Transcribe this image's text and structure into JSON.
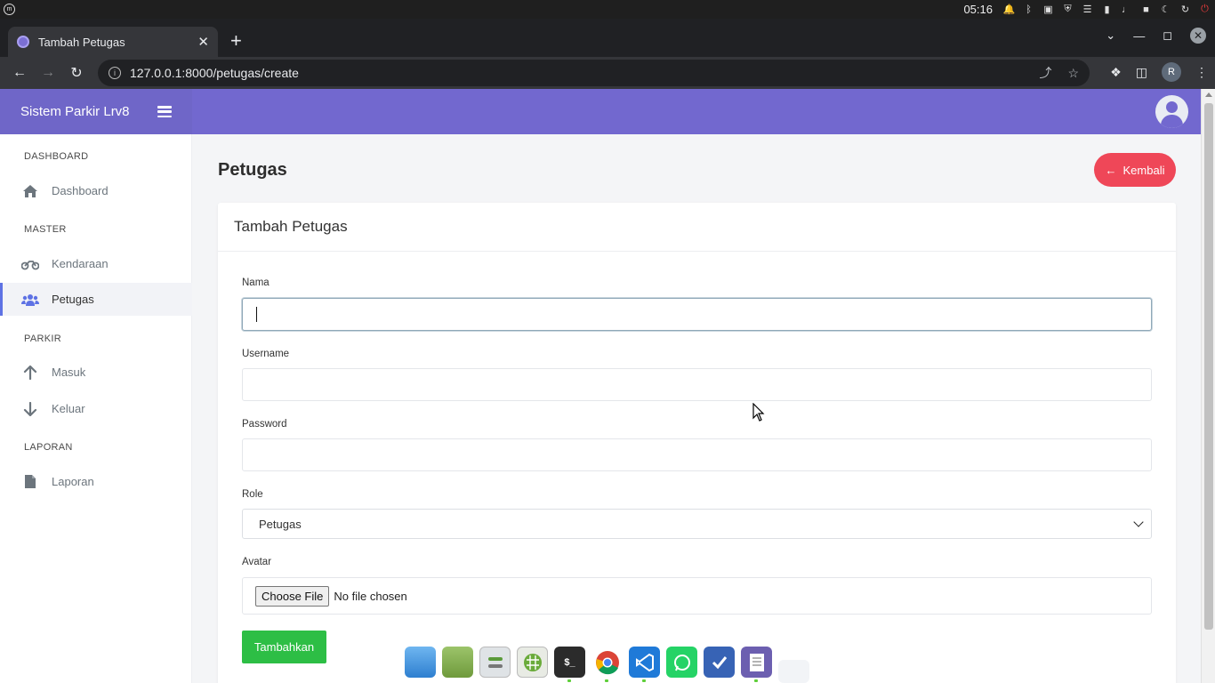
{
  "os": {
    "time": "05:16"
  },
  "browser": {
    "tab_title": "Tambah Petugas",
    "url": "127.0.0.1:8000/petugas/create",
    "profile_initial": "R"
  },
  "app": {
    "brand": "Sistem Parkir Lrv8",
    "accent_color": "#7268cf"
  },
  "sidebar": {
    "sections": [
      {
        "heading": "DASHBOARD",
        "items": [
          {
            "label": "Dashboard",
            "icon": "home-icon"
          }
        ]
      },
      {
        "heading": "MASTER",
        "items": [
          {
            "label": "Kendaraan",
            "icon": "motorcycle-icon"
          },
          {
            "label": "Petugas",
            "icon": "users-icon",
            "active": true
          }
        ]
      },
      {
        "heading": "PARKIR",
        "items": [
          {
            "label": "Masuk",
            "icon": "arrow-up-icon"
          },
          {
            "label": "Keluar",
            "icon": "arrow-down-icon"
          }
        ]
      },
      {
        "heading": "LAPORAN",
        "items": [
          {
            "label": "Laporan",
            "icon": "file-icon"
          }
        ]
      }
    ]
  },
  "main": {
    "page_title": "Petugas",
    "back_button": "Kembali",
    "card_title": "Tambah Petugas",
    "form": {
      "nama_label": "Nama",
      "nama_value": "",
      "username_label": "Username",
      "username_value": "",
      "password_label": "Password",
      "password_value": "",
      "role_label": "Role",
      "role_selected": "Petugas",
      "avatar_label": "Avatar",
      "file_button": "Choose File",
      "file_status": "No file chosen",
      "submit": "Tambahkan"
    }
  },
  "dock": {
    "apps": [
      "files-icon",
      "folder-icon",
      "settings-icon",
      "spreadsheet-icon",
      "terminal-icon",
      "chrome-icon",
      "vscode-icon",
      "whatsapp-icon",
      "tasks-icon",
      "text-editor-icon",
      "screenshot-icon"
    ],
    "terminal_label": "$_"
  }
}
